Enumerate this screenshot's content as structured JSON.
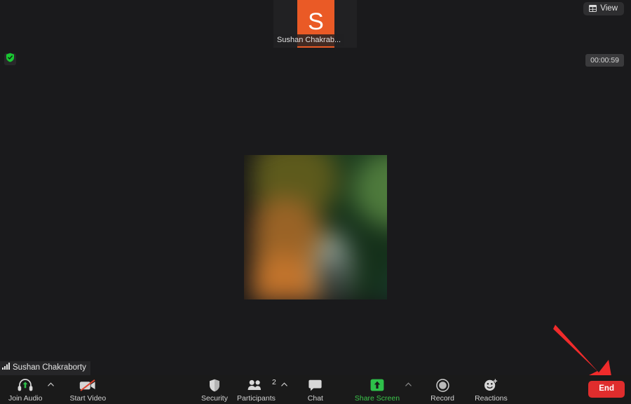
{
  "app": {
    "name": "Zoom Meeting",
    "background_color": "#1a1a1c",
    "toolbar_color": "#1a1a1a"
  },
  "header": {
    "view_button_label": "View",
    "view_icon": "grid-view-icon",
    "encryption_icon": "green-shield-check-icon",
    "meeting_timer": "00:00:59"
  },
  "thumbnail_strip": {
    "participants": [
      {
        "initial": "S",
        "name_truncated": "Sushan Chakrab...",
        "avatar_color": "#ea5a26"
      }
    ]
  },
  "speaker_view": {
    "video_state": "blurred-video-feed",
    "self_name": "Sushan Chakraborty",
    "signal_icon": "signal-bars-icon"
  },
  "annotation": {
    "arrow_color": "#f02b2b",
    "arrow_points_to": "end-button"
  },
  "toolbar": {
    "left_items": [
      {
        "label": "Join Audio",
        "icon": "headset-join-audio-icon",
        "has_caret": true,
        "label_color": "#d2d2d2"
      },
      {
        "label": "Start Video",
        "icon": "camera-off-icon",
        "has_caret": false,
        "label_color": "#d2d2d2"
      }
    ],
    "center_items": [
      {
        "label": "Security",
        "icon": "shield-icon",
        "has_caret": false,
        "badge": "",
        "label_color": "#d2d2d2"
      },
      {
        "label": "Participants",
        "icon": "participants-icon",
        "has_caret": true,
        "badge": "2",
        "label_color": "#d2d2d2"
      },
      {
        "label": "Chat",
        "icon": "chat-bubble-icon",
        "has_caret": false,
        "badge": "",
        "label_color": "#d2d2d2"
      },
      {
        "label": "Share Screen",
        "icon": "share-screen-icon",
        "has_caret": true,
        "badge": "",
        "label_color": "#3bc44a"
      },
      {
        "label": "Record",
        "icon": "record-circle-icon",
        "has_caret": false,
        "badge": "",
        "label_color": "#d2d2d2"
      },
      {
        "label": "Reactions",
        "icon": "reactions-smiley-icon",
        "has_caret": false,
        "badge": "",
        "label_color": "#d2d2d2"
      }
    ],
    "end_button_label": "End",
    "end_button_color": "#e02d2d"
  }
}
